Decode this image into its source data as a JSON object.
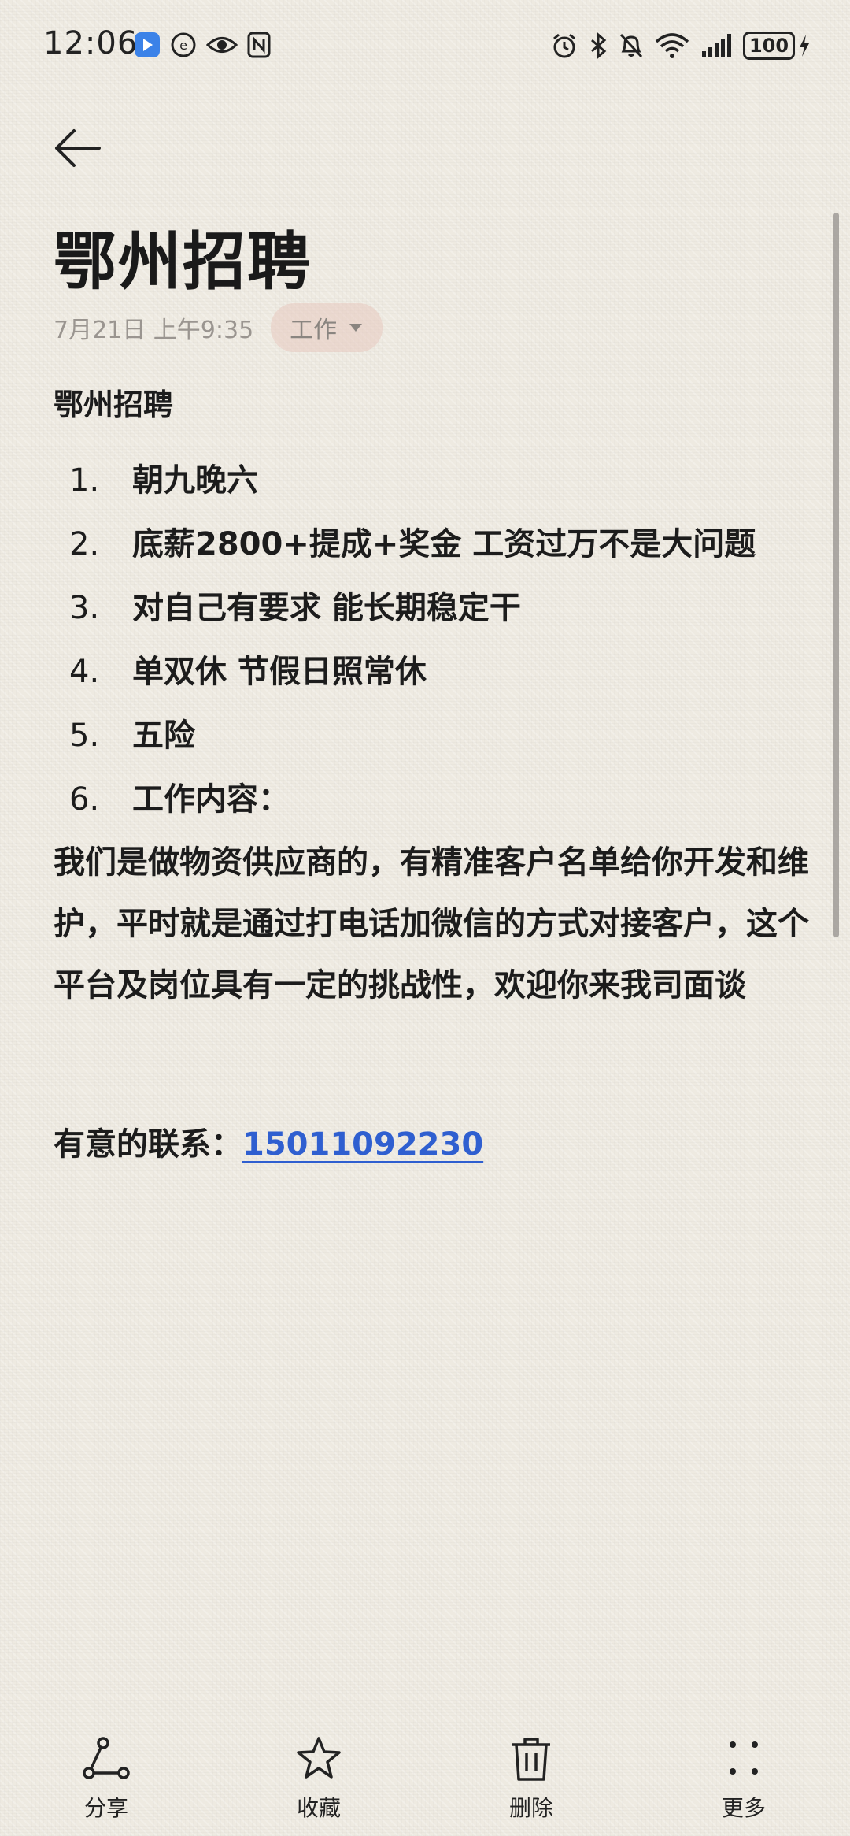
{
  "status_bar": {
    "time": "12:06",
    "battery": "100"
  },
  "note": {
    "title": "鄂州招聘",
    "date": "7月21日 上午9:35",
    "category": "工作",
    "heading": "鄂州招聘",
    "items": [
      {
        "num": "1.",
        "text": "朝九晚六"
      },
      {
        "num": "2.",
        "text": "底薪2800+提成+奖金 工资过万不是大问题"
      },
      {
        "num": "3.",
        "text": "对自己有要求  能长期稳定干"
      },
      {
        "num": "4.",
        "text": "单双休 节假日照常休"
      },
      {
        "num": "5.",
        "text": "五险"
      },
      {
        "num": "6.",
        "text": "工作内容："
      }
    ],
    "paragraph": "我们是做物资供应商的，有精准客户名单给你开发和维护，平时就是通过打电话加微信的方式对接客户，这个平台及岗位具有一定的挑战性，欢迎你来我司面谈",
    "contact_label": "有意的联系：",
    "contact_phone": "15011092230"
  },
  "toolbar": {
    "share": "分享",
    "favorite": "收藏",
    "delete": "删除",
    "more": "更多"
  },
  "colors": {
    "background": "#eeeae1",
    "link": "#2f5fd0",
    "chip": "#e8c8c0"
  },
  "icons": [
    "back-arrow-icon",
    "share-icon",
    "star-icon",
    "trash-icon",
    "more-icon"
  ]
}
